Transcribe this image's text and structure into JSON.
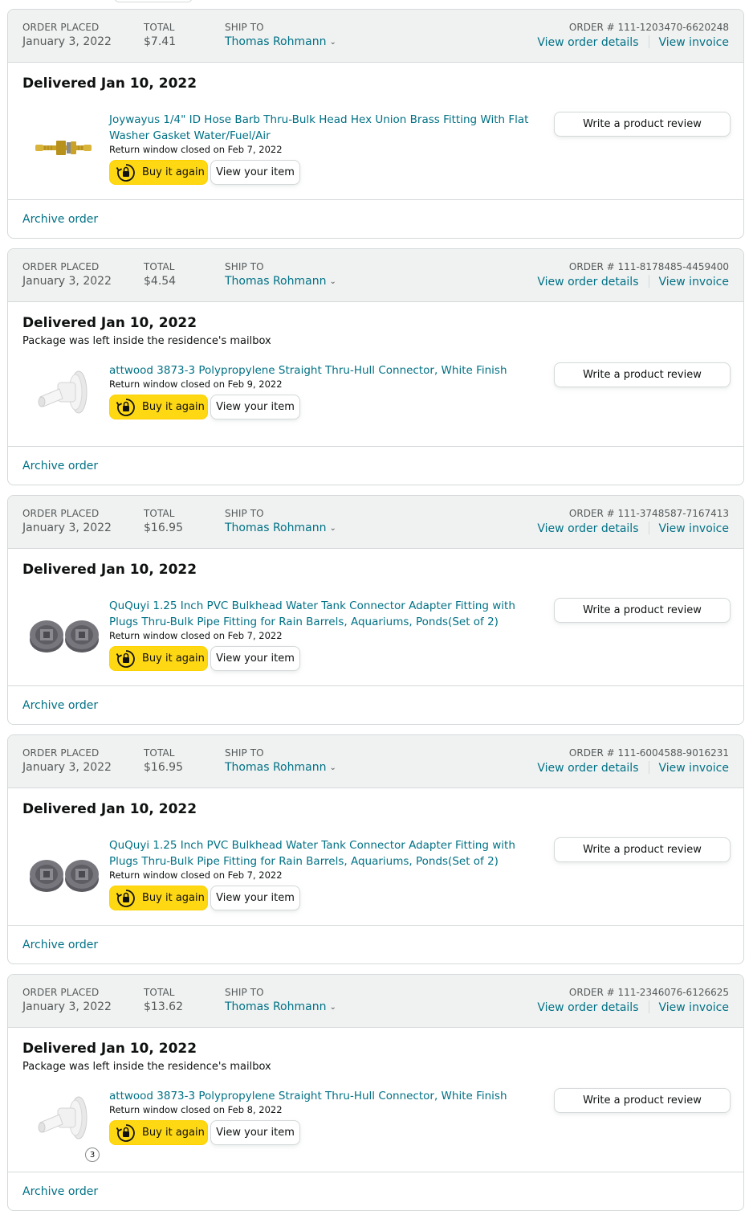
{
  "labels": {
    "order_placed": "ORDER PLACED",
    "total": "TOTAL",
    "ship_to": "SHIP TO",
    "order_number_prefix": "ORDER # ",
    "view_order_details": "View order details",
    "view_invoice": "View invoice",
    "buy_it_again": "Buy it again",
    "view_your_item": "View your item",
    "write_review": "Write a product review",
    "archive_order": "Archive order"
  },
  "colors": {
    "link": "#007185",
    "buy_button": "#FFD814",
    "header_bg": "#F0F2F2",
    "border": "#D5D9D9"
  },
  "orders": [
    {
      "order_date": "January 3, 2022",
      "total": "$7.41",
      "ship_to": "Thomas Rohmann",
      "order_number": "ORDER # 111-1203470-6620248",
      "delivery_status": "Delivered Jan 10, 2022",
      "delivery_note": "",
      "product_title": "Joywayus 1/4\" ID Hose Barb Thru-Bulk Head Hex Union Brass Fitting With Flat Washer Gasket Water/Fuel/Air",
      "return_window": "Return window closed on Feb 7, 2022",
      "product_icon": "brass-hose-barb-fitting"
    },
    {
      "order_date": "January 3, 2022",
      "total": "$4.54",
      "ship_to": "Thomas Rohmann",
      "order_number": "ORDER # 111-8178485-4459400",
      "delivery_status": "Delivered Jan 10, 2022",
      "delivery_note": "Package was left inside the residence's mailbox",
      "product_title": "attwood 3873-3 Polypropylene Straight Thru-Hull Connector, White Finish",
      "return_window": "Return window closed on Feb 9, 2022",
      "product_icon": "white-thru-hull-connector"
    },
    {
      "order_date": "January 3, 2022",
      "total": "$16.95",
      "ship_to": "Thomas Rohmann",
      "order_number": "ORDER # 111-3748587-7167413",
      "delivery_status": "Delivered Jan 10, 2022",
      "delivery_note": "",
      "product_title": "QuQuyi 1.25 Inch PVC Bulkhead Water Tank Connector Adapter Fitting with Plugs Thru-Bulk Pipe Fitting for Rain Barrels, Aquariums, Ponds(Set of 2)",
      "return_window": "Return window closed on Feb 7, 2022",
      "product_icon": "gray-pvc-bulkhead-fittings"
    },
    {
      "order_date": "January 3, 2022",
      "total": "$16.95",
      "ship_to": "Thomas Rohmann",
      "order_number": "ORDER # 111-6004588-9016231",
      "delivery_status": "Delivered Jan 10, 2022",
      "delivery_note": "",
      "product_title": "QuQuyi 1.25 Inch PVC Bulkhead Water Tank Connector Adapter Fitting with Plugs Thru-Bulk Pipe Fitting for Rain Barrels, Aquariums, Ponds(Set of 2)",
      "return_window": "Return window closed on Feb 7, 2022",
      "product_icon": "gray-pvc-bulkhead-fittings"
    },
    {
      "order_date": "January 3, 2022",
      "total": "$13.62",
      "ship_to": "Thomas Rohmann",
      "order_number": "ORDER # 111-2346076-6126625",
      "delivery_status": "Delivered Jan 10, 2022",
      "delivery_note": "Package was left inside the residence's mailbox",
      "product_title": "attwood 3873-3 Polypropylene Straight Thru-Hull Connector, White Finish",
      "return_window": "Return window closed on Feb 8, 2022",
      "product_icon": "white-thru-hull-connector",
      "quantity": "3"
    }
  ]
}
